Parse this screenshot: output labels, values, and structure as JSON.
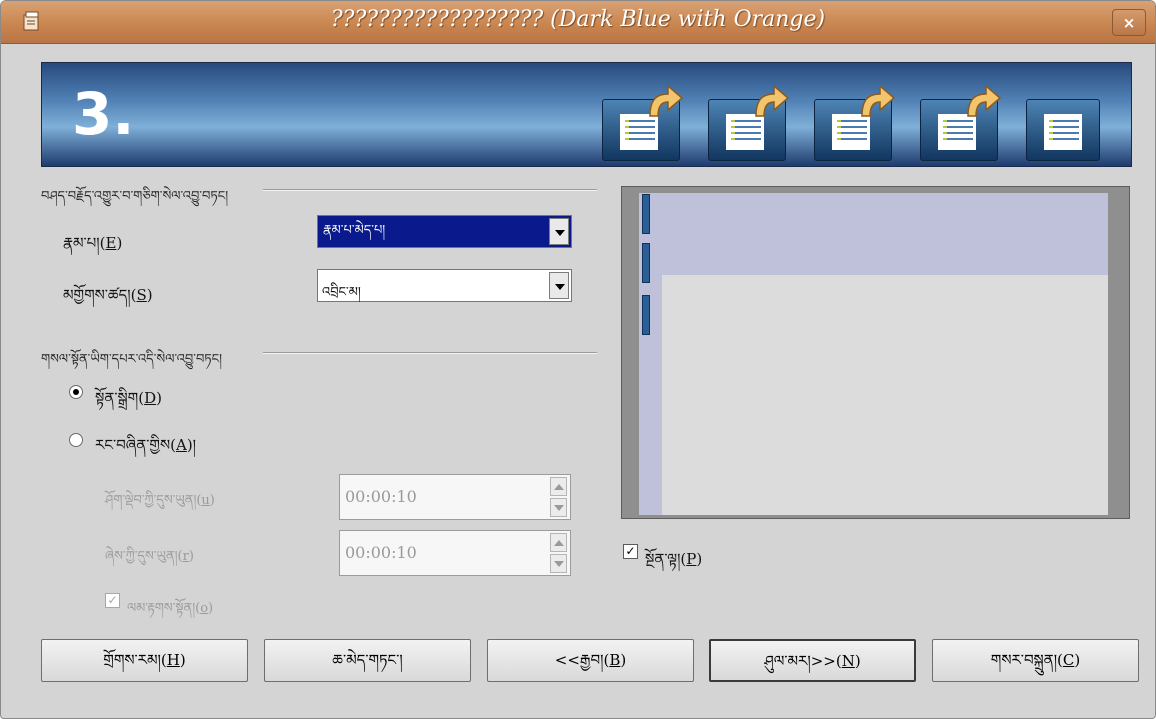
{
  "window": {
    "title": "?????????????????? (Dark Blue with Orange)",
    "close_label": "×"
  },
  "banner": {
    "step_number": "3."
  },
  "section1": {
    "heading": "བཤད་བརྗོད་འགྱུར་བ་གཅིག་སེལ་འབྱུ་བཏང།"
  },
  "effect": {
    "label": "རྣམ་པ།",
    "accel": "E",
    "value": "རྣམ་པ་མེད་པ།"
  },
  "speed": {
    "label": "མགྱོགས་ཚད།",
    "accel": "S",
    "value": "འབྲིང་མ།"
  },
  "section2": {
    "heading": "གསལ་སྟོན་ཡིག་དཔར་འདི་སེལ་འབྱུ་བཏང།"
  },
  "manual": {
    "label": "སྟོན་སྒྲིག",
    "accel": "D"
  },
  "automatic": {
    "label": "རང་བཞིན་གྱིས",
    "accel": "A",
    "suffix": "།"
  },
  "page_duration": {
    "label": "ཤོག་ལྡེབ་ཀྱི་དུས་ཡུན།",
    "accel": "u",
    "value": "00:00:10"
  },
  "pause_duration": {
    "label": "ཞེས་ཀྱི་དུས་ཡུན།",
    "accel": "r",
    "value": "00:00:10"
  },
  "show_logo": {
    "label": "ལམ་རྟགས་སྟོན།",
    "accel": "o",
    "checked": "✓"
  },
  "preview_check": {
    "label": "སྔོན་ལྟ།",
    "accel": "P",
    "checked": "✓"
  },
  "buttons": {
    "help": "གྲོགས་རམ།",
    "help_accel": "H",
    "cancel": "ཆ་མེད་གཏང་།",
    "back_prefix": "<<རྒྱབ།",
    "back_accel": "B",
    "next_prefix": "ཤུལ་མར།>>",
    "next_accel": "N",
    "create": "གསར་བསྐྲུན།",
    "create_accel": "C"
  },
  "colors": {
    "titlebar": "#c98650",
    "banner": "#274a7e",
    "selection": "#0a1a8c",
    "preview_tab": "#2a5e96"
  }
}
